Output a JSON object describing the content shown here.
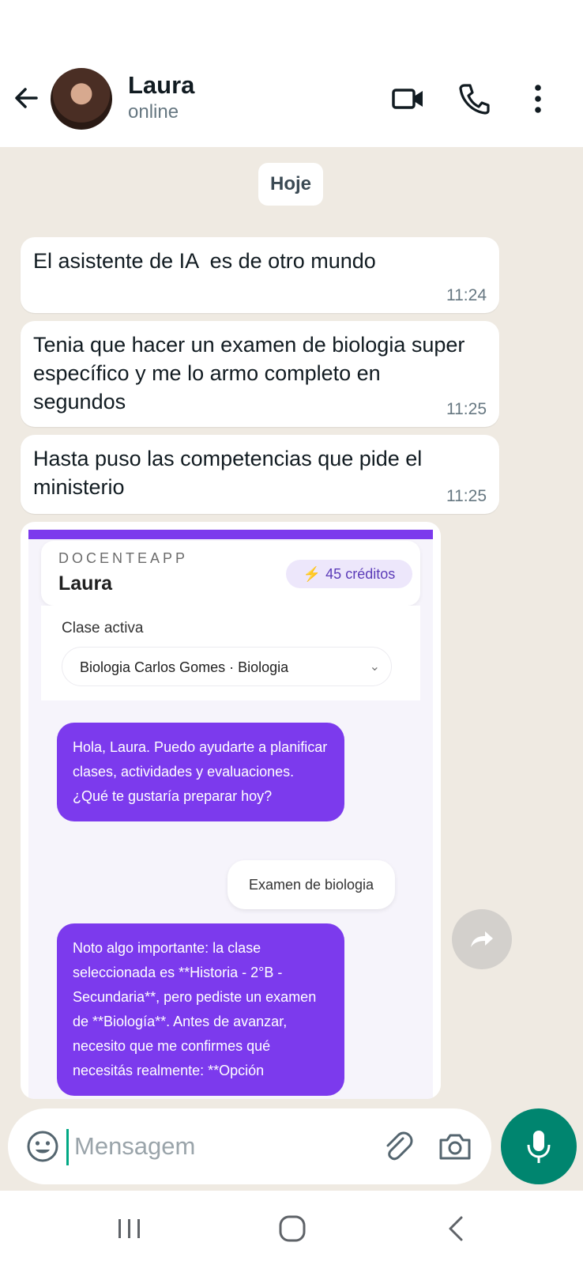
{
  "contact": {
    "name": "Laura",
    "status": "online"
  },
  "date_chip": "Hoje",
  "messages": [
    {
      "text": "El asistente de IA  es de otro mundo",
      "time": "11:24"
    },
    {
      "text": "Tenia que hacer un examen de biologia super específico y me lo armo completo en segundos",
      "time": "11:25"
    },
    {
      "text": "Hasta puso las competencias que pide el ministerio",
      "time": "11:25"
    }
  ],
  "screenshot": {
    "app_name": "DOCENTEAPP",
    "user": "Laura",
    "credits": "45 créditos",
    "clase_label": "Clase activa",
    "clase_value": "Biologia Carlos Gomes · Biologia",
    "ai_message_1": "Hola, Laura. Puedo ayudarte a planificar clases, actividades y evaluaciones. ¿Qué te gustaría preparar hoy?",
    "user_message": "Examen de biologia",
    "ai_message_2": "Noto algo importante: la clase seleccionada es **Historia - 2°B - Secundaria**, pero pediste un examen de **Biología**. Antes de avanzar, necesito que me confirmes qué necesitás realmente: **Opción"
  },
  "composer": {
    "placeholder": "Mensagem"
  },
  "colors": {
    "accent": "#00856f",
    "chat_bg": "#efeae2",
    "app_purple": "#7c3aed"
  }
}
